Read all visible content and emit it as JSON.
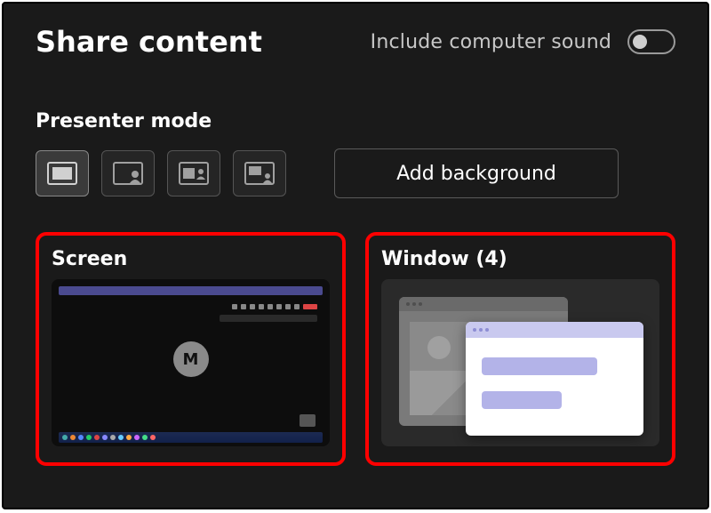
{
  "header": {
    "title": "Share content",
    "include_sound_label": "Include computer sound",
    "include_sound_on": false
  },
  "presenter": {
    "label": "Presenter mode",
    "modes": [
      {
        "id": "content-only",
        "selected": true
      },
      {
        "id": "standout",
        "selected": false
      },
      {
        "id": "side-by-side",
        "selected": false
      },
      {
        "id": "reporter",
        "selected": false
      }
    ],
    "add_background_label": "Add background"
  },
  "sources": {
    "screen": {
      "title": "Screen",
      "avatar_initial": "M"
    },
    "window": {
      "title": "Window (4)"
    }
  },
  "colors": {
    "highlight": "#ff0000",
    "accent_light": "#b3b3e8",
    "accent_tab": "#c9c9ef"
  }
}
